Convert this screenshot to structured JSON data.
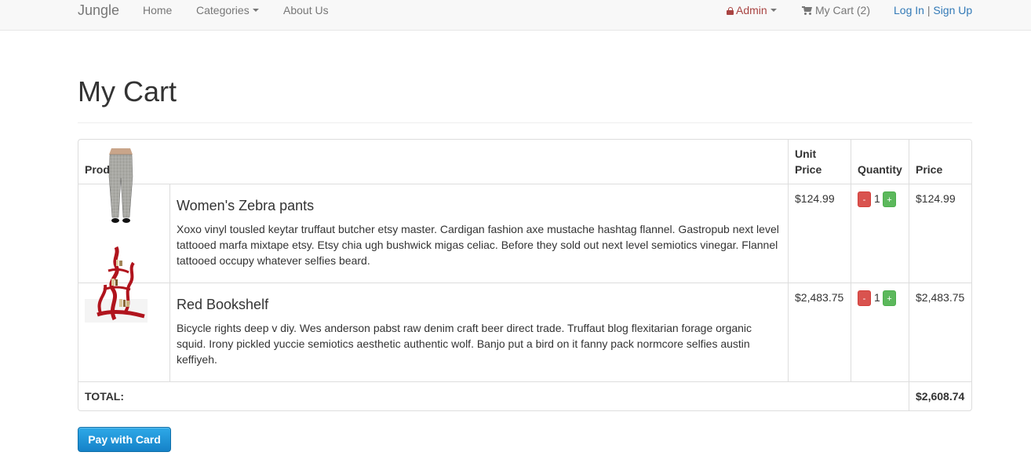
{
  "navbar": {
    "brand": "Jungle",
    "links": {
      "home": "Home",
      "categories": "Categories",
      "about": "About Us"
    },
    "admin": "Admin",
    "cart": "My Cart (2)",
    "login": "Log In",
    "separator": "|",
    "signup": "Sign Up"
  },
  "page": {
    "title": "My Cart"
  },
  "table": {
    "headers": {
      "product": "Product",
      "unit_price": "Unit Price",
      "quantity": "Quantity",
      "price": "Price"
    },
    "items": [
      {
        "name": "Women's Zebra pants",
        "description": "Xoxo vinyl tousled keytar truffaut butcher etsy master. Cardigan fashion axe mustache hashtag flannel. Gastropub next level tattooed marfa mixtape etsy. Etsy chia ugh bushwick migas celiac. Before they sold out next level semiotics vinegar. Flannel tattooed occupy whatever selfies beard.",
        "unit_price": "$124.99",
        "quantity": "1",
        "price": "$124.99",
        "minus": "-",
        "plus": "+",
        "image_icon": "pants-image"
      },
      {
        "name": "Red Bookshelf",
        "description": "Bicycle rights deep v diy. Wes anderson pabst raw denim craft beer direct trade. Truffaut blog flexitarian forage organic squid. Irony pickled yuccie semiotics aesthetic authentic wolf. Banjo put a bird on it fanny pack normcore selfies austin keffiyeh.",
        "unit_price": "$2,483.75",
        "quantity": "1",
        "price": "$2,483.75",
        "minus": "-",
        "plus": "+",
        "image_icon": "bookshelf-image"
      }
    ],
    "total_label": "TOTAL:",
    "total_value": "$2,608.74"
  },
  "actions": {
    "pay": "Pay with Card"
  },
  "colors": {
    "admin": "#a94442",
    "link": "#337ab7",
    "minus": "#d9534f",
    "plus": "#5cb85c",
    "pay": "#1b8fd6"
  }
}
